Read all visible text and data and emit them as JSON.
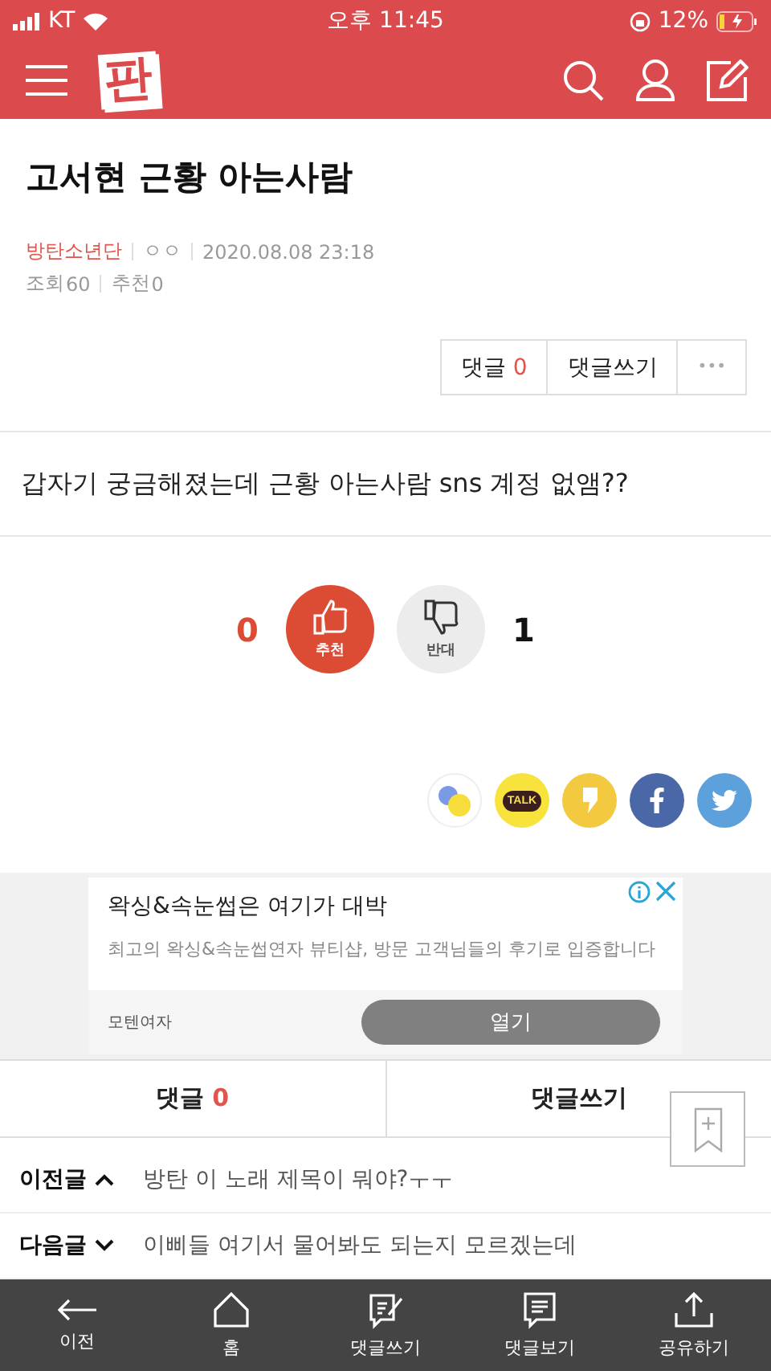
{
  "status_bar": {
    "carrier": "KT",
    "time": "오후 11:45",
    "battery": "12%"
  },
  "header": {
    "logo": "판"
  },
  "post": {
    "title": "고서현 근황 아는사람",
    "board": "방탄소년단",
    "author": "ㅇㅇ",
    "date": "2020.08.08 23:18",
    "views_label": "조회",
    "views": "60",
    "recommend_label": "추천",
    "recommend": "0",
    "body": "갑자기 궁금해졌는데 근황 아는사람 sns 계정 없앰??"
  },
  "actions": {
    "comments_label": "댓글",
    "comments_count": "0",
    "write": "댓글쓰기",
    "more": "•••"
  },
  "votes": {
    "up_count": "0",
    "up_label": "추천",
    "down_label": "반대",
    "down_count": "1"
  },
  "share": [
    {
      "kind": "dots"
    },
    {
      "kind": "talk",
      "text": "TALK"
    },
    {
      "kind": "story"
    },
    {
      "kind": "facebook"
    },
    {
      "kind": "twitter"
    }
  ],
  "ad": {
    "title": "왁싱&속눈썹은 여기가 대박",
    "description": "최고의 왁싱&속눈썹연자 뷰티샵, 방문 고객님들의 후기로 입증합니다",
    "advertiser": "모텐여자",
    "button": "열기"
  },
  "comment_bar": {
    "comments_label": "댓글",
    "comments_count": "0",
    "write": "댓글쓰기"
  },
  "nav_posts": [
    {
      "label": "이전글",
      "kind": "up",
      "title": "방탄 이 노래 제목이 뭐야?ㅜㅜ"
    },
    {
      "label": "다음글",
      "kind": "down",
      "title": "이삐들 여기서 물어봐도 되는지 모르겠는데"
    }
  ],
  "bottom_bar": [
    {
      "kind": "back",
      "label": "이전"
    },
    {
      "kind": "home",
      "label": "홈"
    },
    {
      "kind": "write",
      "label": "댓글쓰기"
    },
    {
      "kind": "comments",
      "label": "댓글보기"
    },
    {
      "kind": "share",
      "label": "공유하기"
    }
  ]
}
